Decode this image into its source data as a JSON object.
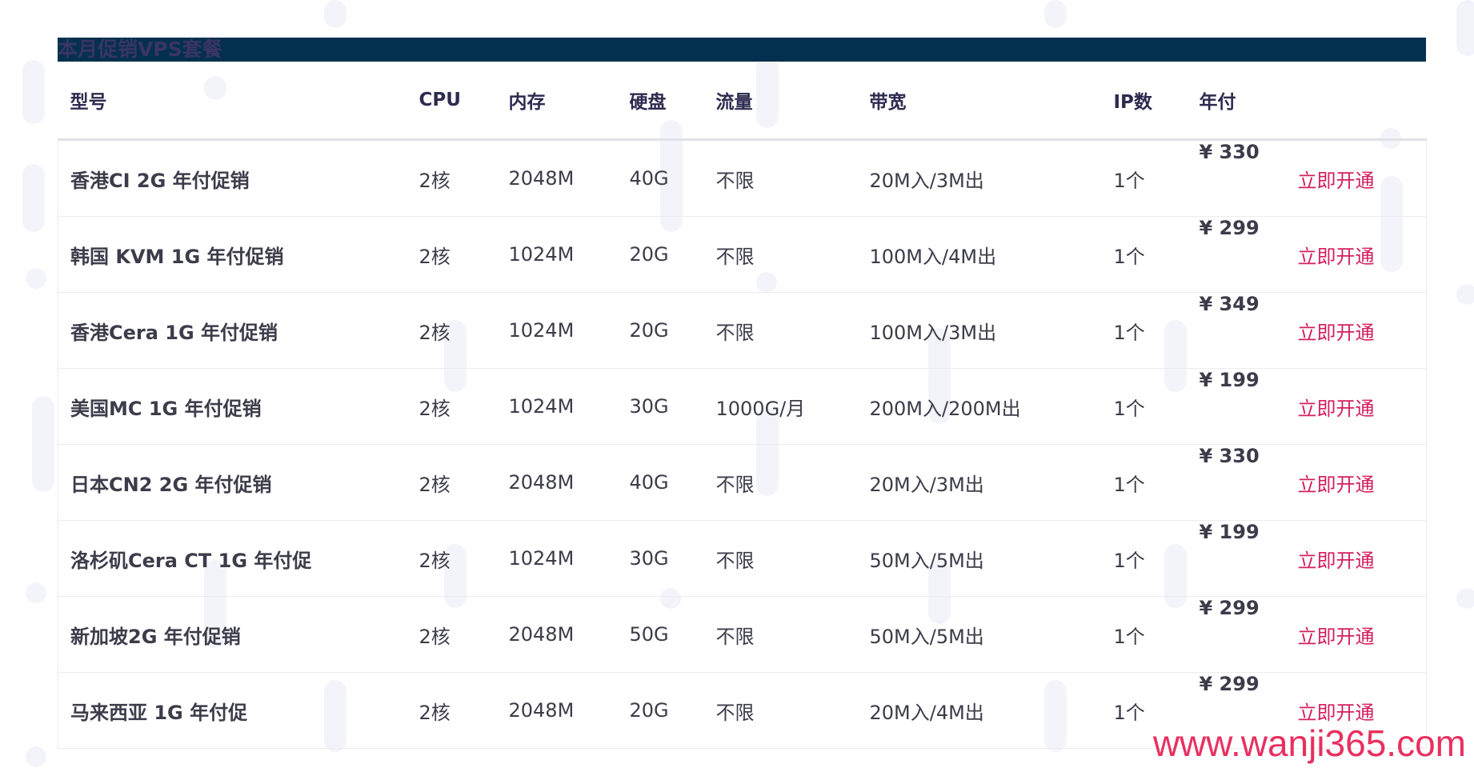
{
  "title": "本月促销VPS套餐",
  "columns": [
    "型号",
    "CPU",
    "内存",
    "硬盘",
    "流量",
    "带宽",
    "IP数",
    "年付",
    ""
  ],
  "rows": [
    {
      "model": "香港CI 2G 年付促销",
      "cpu": "2核",
      "memory": "2048M",
      "disk": "40G",
      "traffic": "不限",
      "bandwidth": "20M入/3M出",
      "ips": "1个",
      "price": "¥ 330",
      "action": "立即开通"
    },
    {
      "model": "韩国 KVM 1G 年付促销",
      "cpu": "2核",
      "memory": "1024M",
      "disk": "20G",
      "traffic": "不限",
      "bandwidth": "100M入/4M出",
      "ips": "1个",
      "price": "¥ 299",
      "action": "立即开通"
    },
    {
      "model": "香港Cera 1G 年付促销",
      "cpu": "2核",
      "memory": "1024M",
      "disk": "20G",
      "traffic": "不限",
      "bandwidth": "100M入/3M出",
      "ips": "1个",
      "price": "¥ 349",
      "action": "立即开通"
    },
    {
      "model": "美国MC 1G 年付促销",
      "cpu": "2核",
      "memory": "1024M",
      "disk": "30G",
      "traffic": "1000G/月",
      "bandwidth": "200M入/200M出",
      "ips": "1个",
      "price": "¥ 199",
      "action": "立即开通"
    },
    {
      "model": "日本CN2 2G 年付促销",
      "cpu": "2核",
      "memory": "2048M",
      "disk": "40G",
      "traffic": "不限",
      "bandwidth": "20M入/3M出",
      "ips": "1个",
      "price": "¥ 330",
      "action": "立即开通"
    },
    {
      "model": "洛杉矶Cera CT 1G 年付促",
      "cpu": "2核",
      "memory": "1024M",
      "disk": "30G",
      "traffic": "不限",
      "bandwidth": "50M入/5M出",
      "ips": "1个",
      "price": "¥ 199",
      "action": "立即开通"
    },
    {
      "model": "新加坡2G 年付促销",
      "cpu": "2核",
      "memory": "2048M",
      "disk": "50G",
      "traffic": "不限",
      "bandwidth": "50M入/5M出",
      "ips": "1个",
      "price": "¥ 299",
      "action": "立即开通"
    },
    {
      "model": "马来西亚 1G 年付促",
      "cpu": "2核",
      "memory": "2048M",
      "disk": "20G",
      "traffic": "不限",
      "bandwidth": "20M入/4M出",
      "ips": "1个",
      "price": "¥ 299",
      "action": "立即开通"
    }
  ],
  "watermark": "www.wanji365.com",
  "colors": {
    "title_bar": "#03304f",
    "title_text": "#3a3563",
    "action_link": "#d1205f",
    "watermark": "#e8305f"
  }
}
